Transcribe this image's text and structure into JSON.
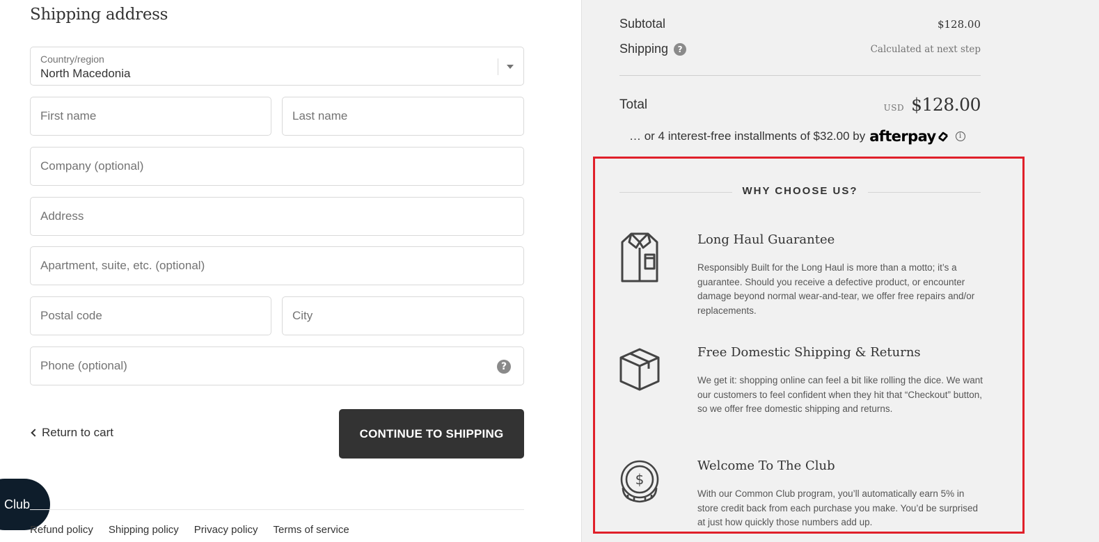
{
  "form": {
    "section_title": "Shipping address",
    "country": {
      "label": "Country/region",
      "value": "North Macedonia"
    },
    "first_name": {
      "placeholder": "First name"
    },
    "last_name": {
      "placeholder": "Last name"
    },
    "company": {
      "placeholder": "Company (optional)"
    },
    "address": {
      "placeholder": "Address"
    },
    "apartment": {
      "placeholder": "Apartment, suite, etc. (optional)"
    },
    "postal_code": {
      "placeholder": "Postal code"
    },
    "city": {
      "placeholder": "City"
    },
    "phone": {
      "placeholder": "Phone (optional)"
    },
    "help_glyph": "?",
    "return_label": "Return to cart",
    "continue_label": "CONTINUE TO SHIPPING"
  },
  "club_badge": "Club",
  "footer": {
    "links": [
      "Refund policy",
      "Shipping policy",
      "Privacy policy",
      "Terms of service"
    ]
  },
  "summary": {
    "subtotal_label": "Subtotal",
    "subtotal_value": "$128.00",
    "shipping_label": "Shipping",
    "shipping_value": "Calculated at next step",
    "total_label": "Total",
    "currency": "USD",
    "total_value": "$128.00",
    "afterpay_text": "… or 4 interest-free installments of $32.00 by",
    "afterpay_logo": "afterpay",
    "info_glyph": "i"
  },
  "why": {
    "title": "WHY CHOOSE US?",
    "features": [
      {
        "icon": "shirt-icon",
        "title": "Long Haul Guarantee",
        "text": "Responsibly Built for the Long Haul is more than a motto; it’s a guarantee. Should you receive a defective product, or encounter damage beyond normal wear-and-tear, we offer free repairs and/or replacements."
      },
      {
        "icon": "box-icon",
        "title": "Free Domestic Shipping & Returns",
        "text": "We get it: shopping online can feel a bit like rolling the dice. We want our customers to feel confident when they hit that “Checkout” button, so we offer free domestic shipping and returns."
      },
      {
        "icon": "coin-icon",
        "title": "Welcome To The Club",
        "text": "With our Common Club program, you’ll automatically earn 5% in store credit back from each purchase you make. You’d be surprised at just how quickly those numbers add up."
      }
    ]
  },
  "colors": {
    "highlight_border": "#e0202a",
    "button_bg": "#333333",
    "club_badge_bg": "#0e1d2b",
    "sidebar_bg": "#f1f1f1"
  }
}
